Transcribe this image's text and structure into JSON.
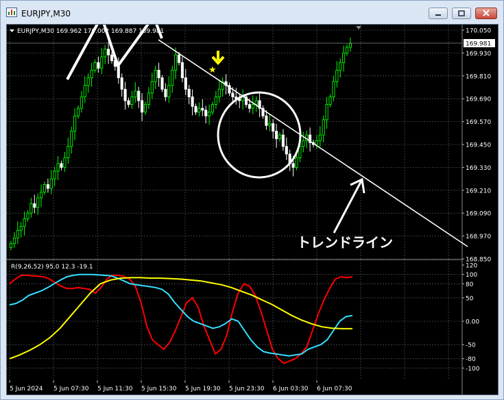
{
  "window": {
    "title": "EURJPY,M30",
    "buttons": {
      "minimize": "minimize",
      "maximize": "maximize",
      "close": "close"
    }
  },
  "chart_header": "EURJPY,M30  169.962 170.002 169.887 169.981",
  "current_price": "169.981",
  "annotation": "トレンドライン",
  "colors": {
    "bg": "#000000",
    "grid": "#4a4a4a",
    "bull": "#00ff00",
    "bear": "#ffffff",
    "red_line": "#ff0000",
    "cyan_line": "#33e0ff",
    "yellow_line": "#ffff00",
    "arrow": "#ffff00",
    "drawing": "#ffffff"
  },
  "chart_data": [
    {
      "type": "candlestick",
      "symbol": "EURJPY",
      "timeframe": "M30",
      "header": "EURJPY,M30  169.962 170.002 169.887 169.981",
      "ylim": [
        168.85,
        170.05
      ],
      "y_ticks": [
        "170.050",
        "169.930",
        "169.810",
        "169.690",
        "169.570",
        "169.450",
        "169.330",
        "169.210",
        "169.090",
        "168.970",
        "168.850"
      ],
      "x_ticks": [
        "5 Jun 2024",
        "5 Jun 07:30",
        "5 Jun 11:30",
        "5 Jun 15:30",
        "5 Jun 19:30",
        "5 Jun 23:30",
        "6 Jun 03:30",
        "6 Jun 07:30"
      ],
      "closes": [
        168.93,
        168.96,
        169.0,
        169.02,
        169.06,
        169.09,
        169.14,
        169.12,
        169.17,
        169.2,
        169.24,
        169.22,
        169.27,
        169.31,
        169.35,
        169.33,
        169.38,
        169.44,
        169.52,
        169.6,
        169.64,
        169.7,
        169.76,
        169.8,
        169.84,
        169.88,
        169.85,
        169.91,
        169.95,
        169.92,
        169.89,
        169.86,
        169.8,
        169.74,
        169.68,
        169.66,
        169.7,
        169.73,
        169.68,
        169.62,
        169.66,
        169.72,
        169.78,
        169.84,
        169.8,
        169.74,
        169.7,
        169.76,
        169.84,
        169.92,
        169.88,
        169.8,
        169.74,
        169.7,
        169.65,
        169.62,
        169.64,
        169.63,
        169.6,
        169.62,
        169.66,
        169.7,
        169.74,
        169.78,
        169.76,
        169.72,
        169.7,
        169.69,
        169.68,
        169.7,
        169.66,
        169.64,
        169.66,
        169.68,
        169.64,
        169.6,
        169.55,
        169.56,
        169.52,
        169.48,
        169.5,
        169.44,
        169.4,
        169.35,
        169.33,
        169.38,
        169.44,
        169.47,
        169.5,
        169.46,
        169.45,
        169.47,
        169.5,
        169.58,
        169.66,
        169.7,
        169.78,
        169.84,
        169.88,
        169.93,
        169.96,
        169.98
      ],
      "current_price": 169.981,
      "annotation_text": "トレンドライン"
    },
    {
      "type": "line",
      "indicator_label": "R(9,26,52) 95.0 12.3 -19.1",
      "ylim": [
        -120,
        120
      ],
      "y_ticks": [
        "120",
        "100",
        "80",
        "50",
        "0.00",
        "-50",
        "-80",
        "-100"
      ],
      "series": [
        {
          "values": [
            80,
            90,
            98,
            98,
            97,
            96,
            95,
            90,
            82,
            75,
            70,
            70,
            72,
            70,
            68,
            60,
            72,
            90,
            98,
            98,
            96,
            90,
            75,
            40,
            -10,
            -40,
            -50,
            -60,
            -45,
            -20,
            10,
            40,
            50,
            30,
            -10,
            -40,
            -70,
            -60,
            -30,
            20,
            60,
            80,
            75,
            55,
            20,
            -20,
            -60,
            -80,
            -90,
            -85,
            -80,
            -70,
            -55,
            -20,
            15,
            45,
            70,
            90,
            95,
            93,
            95
          ]
        },
        {
          "values": [
            35,
            38,
            45,
            55,
            60,
            65,
            72,
            80,
            88,
            95,
            98,
            100,
            100,
            100,
            99,
            98,
            97,
            92,
            86,
            80,
            78,
            76,
            74,
            72,
            68,
            58,
            40,
            25,
            10,
            0,
            -5,
            -10,
            -15,
            -12,
            -5,
            5,
            0,
            -20,
            -40,
            -55,
            -65,
            -68,
            -70,
            -72,
            -74,
            -72,
            -70,
            -60,
            -55,
            -50,
            -40,
            -20,
            0,
            10,
            12
          ]
        },
        {
          "values": [
            -80,
            -72,
            -62,
            -50,
            -35,
            -15,
            10,
            35,
            60,
            80,
            88,
            92,
            93,
            93,
            92,
            92,
            91,
            90,
            88,
            86,
            82,
            78,
            72,
            64,
            56,
            46,
            36,
            24,
            12,
            2,
            -6,
            -12,
            -15,
            -16,
            -16
          ]
        }
      ]
    }
  ]
}
